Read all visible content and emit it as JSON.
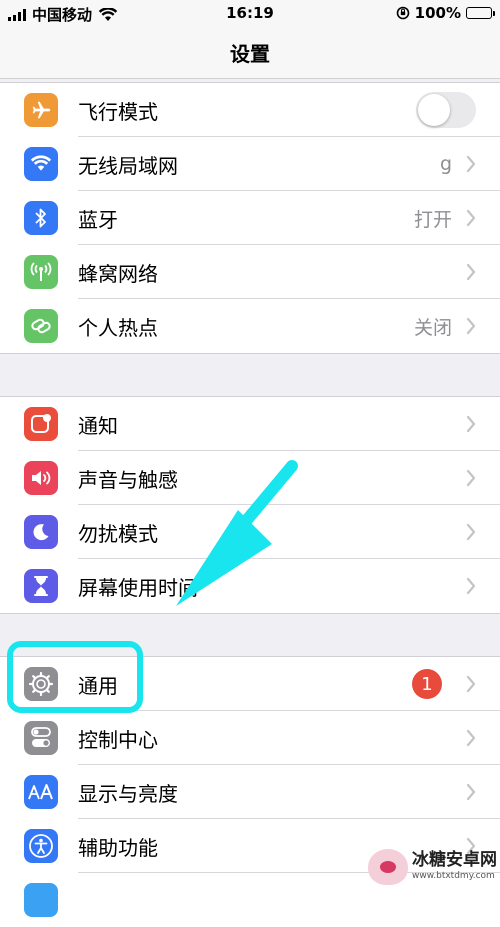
{
  "status_bar": {
    "carrier": "中国移动",
    "time": "16:19",
    "battery": "100%",
    "battery_level": 1.0
  },
  "nav": {
    "title": "设置"
  },
  "group1": [
    {
      "label": "飞行模式",
      "icon": "airplane-icon",
      "color": "#f09a37",
      "type": "toggle",
      "on": false
    },
    {
      "label": "无线局域网",
      "icon": "wifi-icon",
      "color": "#3478f6",
      "value": "g"
    },
    {
      "label": "蓝牙",
      "icon": "bluetooth-icon",
      "color": "#3478f6",
      "value": "打开"
    },
    {
      "label": "蜂窝网络",
      "icon": "cellular-antenna-icon",
      "color": "#65c466"
    },
    {
      "label": "个人热点",
      "icon": "hotspot-chain-icon",
      "color": "#65c466",
      "value": "关闭"
    }
  ],
  "group2": [
    {
      "label": "通知",
      "icon": "notifications-icon",
      "color": "#eb4d3d"
    },
    {
      "label": "声音与触感",
      "icon": "speaker-icon",
      "color": "#eb445a"
    },
    {
      "label": "勿扰模式",
      "icon": "moon-icon",
      "color": "#5e5ce6"
    },
    {
      "label": "屏幕使用时间",
      "icon": "hourglass-icon",
      "color": "#5e5ce6"
    }
  ],
  "group3": [
    {
      "label": "通用",
      "icon": "gear-icon",
      "color": "#8e8e93",
      "badge": "1"
    },
    {
      "label": "控制中心",
      "icon": "control-center-icon",
      "color": "#8e8e93"
    },
    {
      "label": "显示与亮度",
      "icon": "text-size-icon",
      "color": "#3478f6"
    },
    {
      "label": "辅助功能",
      "icon": "accessibility-icon",
      "color": "#3478f6"
    }
  ],
  "annotation": {
    "highlight_color": "#19e5ef",
    "arrow_color": "#19e5ef"
  },
  "watermark": {
    "title": "冰糖安卓网",
    "url": "www.btxtdmy.com"
  }
}
